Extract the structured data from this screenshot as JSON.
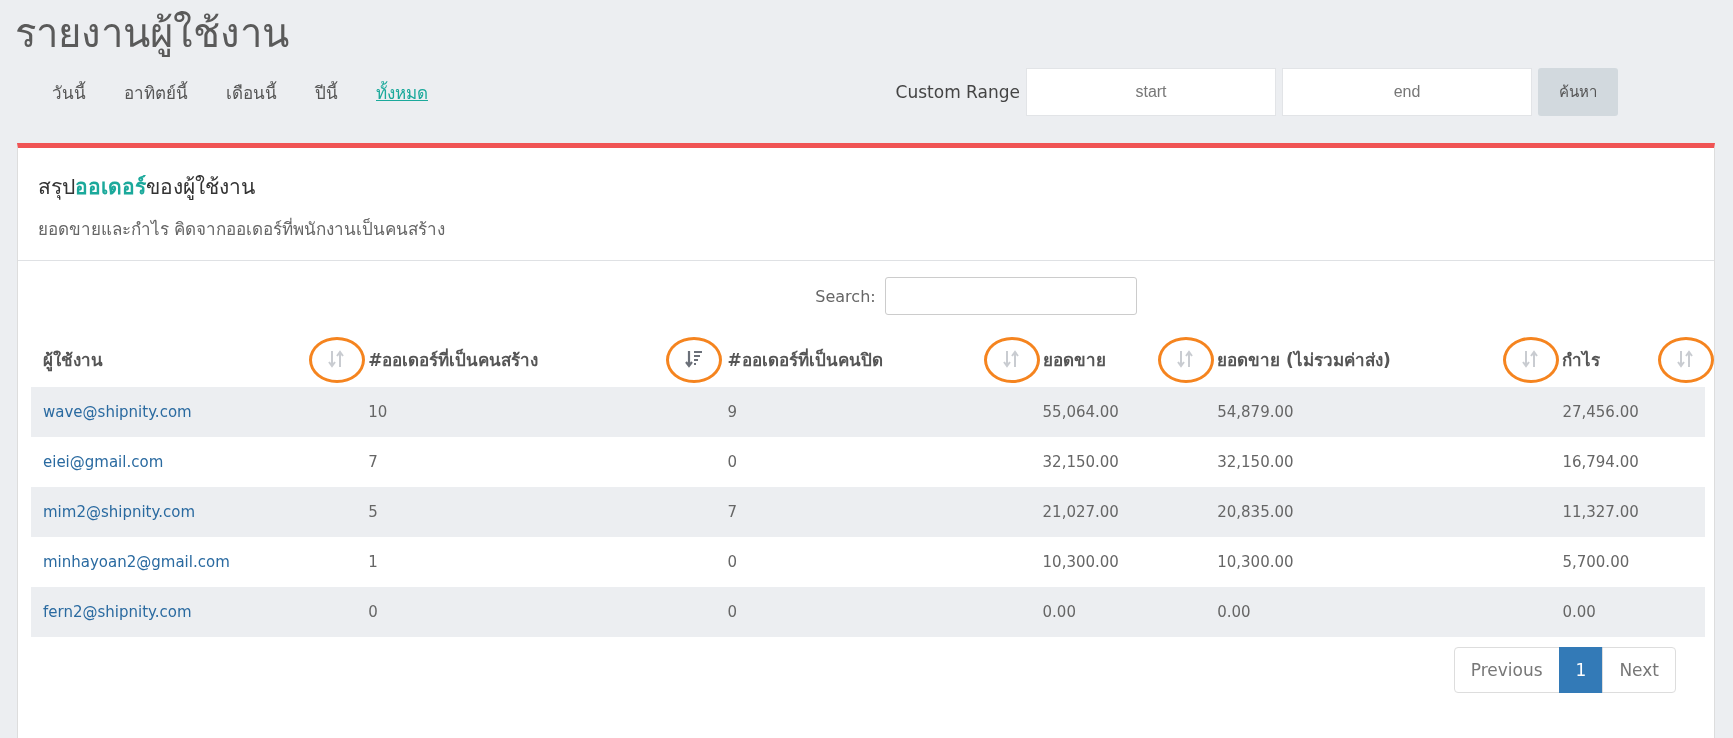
{
  "page_title": "รายงานผู้ใช้งาน",
  "period_tabs": [
    {
      "label": "วันนี้",
      "selected": false
    },
    {
      "label": "อาทิตย์นี้",
      "selected": false
    },
    {
      "label": "เดือนนี้",
      "selected": false
    },
    {
      "label": "ปีนี้",
      "selected": false
    },
    {
      "label": "ทั้งหมด",
      "selected": true
    }
  ],
  "custom_range": {
    "label": "Custom Range",
    "start_placeholder": "start",
    "end_placeholder": "end",
    "button": "ค้นหา"
  },
  "card": {
    "title": "สรุป**ออเดอร์**ของผู้ใช้งาน",
    "subtitle": "ยอดขายและกำไร คิดจากออเดอร์ที่พนักงานเป็นคนสร้าง"
  },
  "search": {
    "label": "Search:"
  },
  "table": {
    "columns": [
      {
        "label": "ผู้ใช้งาน",
        "sorted_descending": false,
        "circled": true
      },
      {
        "label": "#ออเดอร์ที่เป็นคนสร้าง",
        "sorted_descending": true,
        "circled": true
      },
      {
        "label": "#ออเดอร์ที่เป็นคนปิด",
        "sorted_descending": false,
        "circled": true
      },
      {
        "label": "ยอดขาย",
        "sorted_descending": false,
        "circled": true
      },
      {
        "label": "ยอดขาย (ไม่รวมค่าส่ง)",
        "sorted_descending": false,
        "circled": true
      },
      {
        "label": "กำไร",
        "sorted_descending": false,
        "circled": true
      }
    ],
    "rows": [
      [
        "wave@shipnity.com",
        "10",
        "9",
        "55,064.00",
        "54,879.00",
        "27,456.00"
      ],
      [
        "eiei@gmail.com",
        "7",
        "0",
        "32,150.00",
        "32,150.00",
        "16,794.00"
      ],
      [
        "mim2@shipnity.com",
        "5",
        "7",
        "21,027.00",
        "20,835.00",
        "11,327.00"
      ],
      [
        "minhayoan2@gmail.com",
        "1",
        "0",
        "10,300.00",
        "10,300.00",
        "5,700.00"
      ],
      [
        "fern2@shipnity.com",
        "0",
        "0",
        "0.00",
        "0.00",
        "0.00"
      ]
    ]
  },
  "pagination": {
    "previous": "Previous",
    "pages": [
      {
        "label": "1",
        "selected": true
      }
    ],
    "next": "Next"
  }
}
